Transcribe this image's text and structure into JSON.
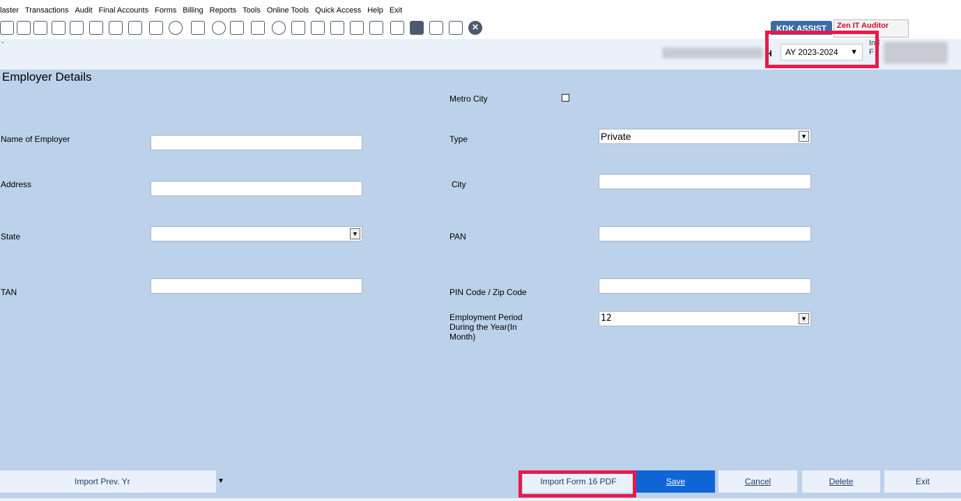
{
  "menu": [
    "laster",
    "Transactions",
    "Audit",
    "Final Accounts",
    "Forms",
    "Billing",
    "Reports",
    "Tools",
    "Online Tools",
    "Quick Access",
    "Help",
    "Exit"
  ],
  "header": {
    "kdk_tab": "KDK ASSIST",
    "zen_tab": "Zen IT Auditor",
    "assessment_year": "AY 2023-2024",
    "ind_text": "Ind",
    "f_text": "F",
    "h_text": "H",
    "backslash": "`"
  },
  "section_title": "Employer Details",
  "form": {
    "metro_city_label": "Metro City",
    "name_label": "Name of Employer",
    "type_label": "Type",
    "type_value": "Private",
    "address_label": "Address",
    "city_label": "City",
    "state_label": "State",
    "pan_label": "PAN",
    "tan_label": "TAN",
    "pin_label": "PIN Code / Zip Code",
    "employment_label_1": "Employment Period",
    "employment_label_2": "During the Year(In",
    "employment_label_3": "Month)",
    "employment_value": "12"
  },
  "bottom": {
    "import_prev": "Import Prev. Yr",
    "import_prev_caret": "▼",
    "import_form16": "Import Form 16 PDF",
    "save": "Save",
    "cancel": "Cancel",
    "delete": "Delete",
    "exit": "Exit"
  }
}
